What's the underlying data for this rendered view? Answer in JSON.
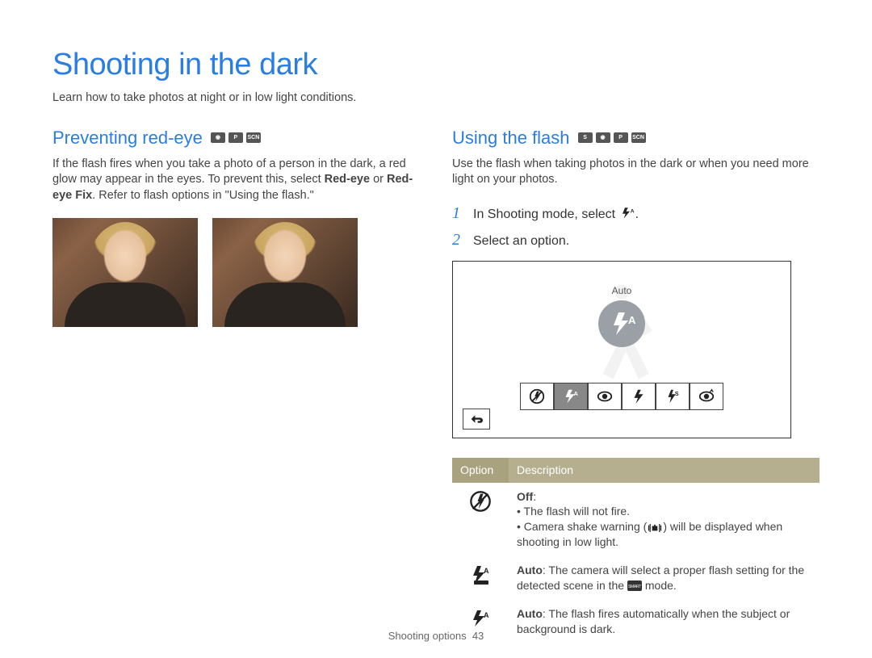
{
  "title": "Shooting in the dark",
  "intro": "Learn how to take photos at night or in low light conditions.",
  "left": {
    "heading": "Preventing red-eye",
    "body_pre": "If the flash fires when you take a photo of a person in the dark, a red glow may appear in the eyes. To prevent this, select ",
    "bold1": "Red-eye",
    "body_mid": " or ",
    "bold2": "Red-eye Fix",
    "body_post": ". Refer to flash options in \"Using the flash.\""
  },
  "right": {
    "heading": "Using the flash",
    "body": "Use the flash when taking photos in the dark or when you need more light on your photos.",
    "step1_num": "1",
    "step1_text": "In Shooting mode, select ",
    "step1_post": ".",
    "step2_num": "2",
    "step2_text": "Select an option.",
    "lcd_label": "Auto",
    "lcd_big_text": "A",
    "table_head_option": "Option",
    "table_head_desc": "Description",
    "row_off_title": "Off",
    "row_off_colon": ":",
    "row_off_b1": "The flash will not fire.",
    "row_off_b2a": "Camera shake warning (",
    "row_off_b2b": ") will be displayed when shooting in low light.",
    "row_auto1_title": "Auto",
    "row_auto1_body_a": ": The camera will select a proper flash setting for the detected scene in the ",
    "row_auto1_body_b": " mode.",
    "row_auto2_title": "Auto",
    "row_auto2_body": ": The flash fires automatically when the subject or background is dark."
  },
  "footer_section": "Shooting options",
  "footer_page": "43"
}
